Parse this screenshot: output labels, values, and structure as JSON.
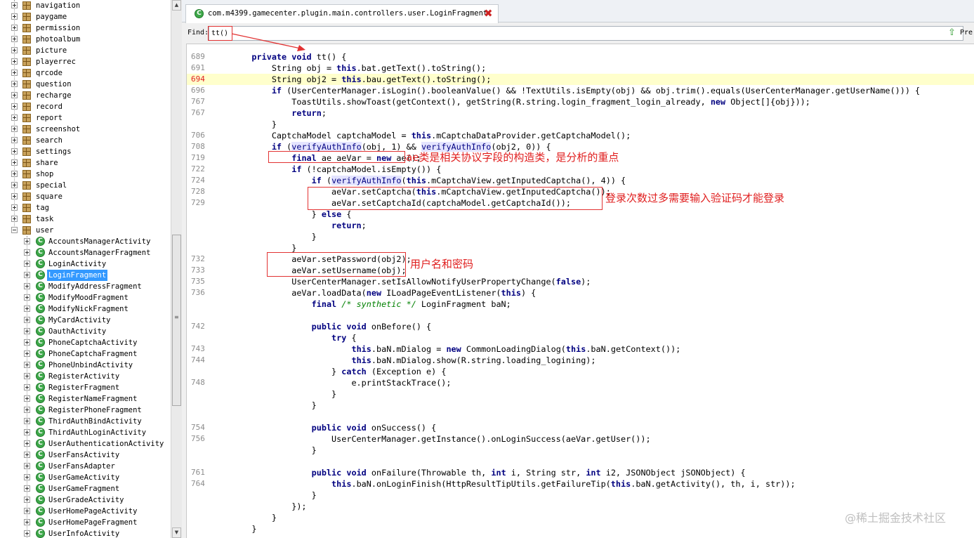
{
  "tree": {
    "packages": [
      "navigation",
      "paygame",
      "permission",
      "photoalbum",
      "picture",
      "playerrec",
      "qrcode",
      "question",
      "recharge",
      "record",
      "report",
      "screenshot",
      "search",
      "settings",
      "share",
      "shop",
      "special",
      "square",
      "tag",
      "task",
      "user"
    ],
    "classes": [
      "AccountsManagerActivity",
      "AccountsManagerFragment",
      "LoginActivity",
      "LoginFragment",
      "ModifyAddressFragment",
      "ModifyMoodFragment",
      "ModifyNickFragment",
      "MyCardActivity",
      "OauthActivity",
      "PhoneCaptchaActivity",
      "PhoneCaptchaFragment",
      "PhoneUnbindActivity",
      "RegisterActivity",
      "RegisterFragment",
      "RegisterNameFragment",
      "RegisterPhoneFragment",
      "ThirdAuthBindActivity",
      "ThirdAuthLoginActivity",
      "UserAuthenticationActivity",
      "UserFansActivity",
      "UserFansAdapter",
      "UserGameActivity",
      "UserGameFragment",
      "UserGradeActivity",
      "UserHomePageActivity",
      "UserHomePageFragment",
      "UserInfoActivity"
    ],
    "selected_class": "LoginFragment",
    "class_icon_letter": "C"
  },
  "tab": {
    "title": "com.m4399.gamecenter.plugin.main.controllers.user.LoginFragment",
    "close_glyph": "✖"
  },
  "find": {
    "label": "Find:",
    "value": "tt()",
    "prev_label": "Pre"
  },
  "editor": {
    "highlighted_line": "694",
    "lines": [
      {
        "n": "689",
        "t": "    <k>private</k> <k>void</k> tt() {"
      },
      {
        "n": "691",
        "t": "        String obj = <k>this</k>.bat.getText().toString();"
      },
      {
        "n": "694",
        "t": "        String obj2 = <k>this</k>.bau.getText().toString();"
      },
      {
        "n": "696",
        "t": "        <k>if</k> (UserCenterManager.isLogin().booleanValue() && !TextUtils.isEmpty(obj) && obj.trim().equals(UserCenterManager.getUserName())) {"
      },
      {
        "n": "767",
        "t": "            ToastUtils.showToast(getContext(), getString(R.string.login_fragment_login_already, <k>new</k> Object[]{obj}));"
      },
      {
        "n": "767",
        "t": "            <k>return</k>;"
      },
      {
        "n": "",
        "t": "        }"
      },
      {
        "n": "706",
        "t": "        CaptchaModel captchaModel = <k>this</k>.mCaptchaDataProvider.getCaptchaModel();"
      },
      {
        "n": "708",
        "t": "        <k>if</k> (<v>verifyAuthInfo</v>(obj, 1) && <v>verifyAuthInfo</v>(obj2, 0)) {"
      },
      {
        "n": "719",
        "t": "            <k>final</k> ae aeVar = <k>new</k> ae();"
      },
      {
        "n": "722",
        "t": "            <k>if</k> (!captchaModel.isEmpty()) {"
      },
      {
        "n": "724",
        "t": "                <k>if</k> (<v>verifyAuthInfo</v>(<k>this</k>.mCaptchaView.getInputedCaptcha(), 4)) {"
      },
      {
        "n": "728",
        "t": "                    aeVar.setCaptcha(<k>this</k>.mCaptchaView.getInputedCaptcha());"
      },
      {
        "n": "729",
        "t": "                    aeVar.setCaptchaId(captchaModel.getCaptchaId());"
      },
      {
        "n": "",
        "t": "                } <k>else</k> {"
      },
      {
        "n": "",
        "t": "                    <k>return</k>;"
      },
      {
        "n": "",
        "t": "                }"
      },
      {
        "n": "",
        "t": "            }"
      },
      {
        "n": "732",
        "t": "            aeVar.setPassword(obj2);"
      },
      {
        "n": "733",
        "t": "            aeVar.setUsername(obj);"
      },
      {
        "n": "735",
        "t": "            UserCenterManager.setIsAllowNotifyUserPropertyChange(<k>false</k>);"
      },
      {
        "n": "736",
        "t": "            aeVar.loadData(<k>new</k> ILoadPageEventListener(<k>this</k>) {"
      },
      {
        "n": "",
        "t": "                <k>final</k> <c>/* synthetic */</c> LoginFragment baN;"
      },
      {
        "n": "",
        "t": ""
      },
      {
        "n": "742",
        "t": "                <k>public</k> <k>void</k> onBefore() {"
      },
      {
        "n": "",
        "t": "                    <k>try</k> {"
      },
      {
        "n": "743",
        "t": "                        <k>this</k>.baN.mDialog = <k>new</k> CommonLoadingDialog(<k>this</k>.baN.getContext());"
      },
      {
        "n": "744",
        "t": "                        <k>this</k>.baN.mDialog.show(R.string.loading_logining);"
      },
      {
        "n": "",
        "t": "                    } <k>catch</k> (Exception e) {"
      },
      {
        "n": "748",
        "t": "                        e.printStackTrace();"
      },
      {
        "n": "",
        "t": "                    }"
      },
      {
        "n": "",
        "t": "                }"
      },
      {
        "n": "",
        "t": ""
      },
      {
        "n": "754",
        "t": "                <k>public</k> <k>void</k> onSuccess() {"
      },
      {
        "n": "756",
        "t": "                    UserCenterManager.getInstance().onLoginSuccess(aeVar.getUser());"
      },
      {
        "n": "",
        "t": "                }"
      },
      {
        "n": "",
        "t": ""
      },
      {
        "n": "761",
        "t": "                <k>public</k> <k>void</k> onFailure(Throwable th, <k>int</k> i, String str, <k>int</k> i2, JSONObject jSONObject) {"
      },
      {
        "n": "764",
        "t": "                    <k>this</k>.baN.onLoginFinish(HttpResultTipUtils.getFailureTip(<k>this</k>.baN.getActivity(), th, i, str));"
      },
      {
        "n": "",
        "t": "                }"
      },
      {
        "n": "",
        "t": "            });"
      },
      {
        "n": "",
        "t": "        }"
      },
      {
        "n": "",
        "t": "    }"
      }
    ]
  },
  "annotations": {
    "ae_note": "ae类是相关协议字段的构造类，是分析的重点",
    "captcha_note": "登录次数过多需要输入验证码才能登录",
    "credentials_note": "用户名和密码",
    "color": "#e02020"
  },
  "watermark": "@稀土掘金技术社区"
}
